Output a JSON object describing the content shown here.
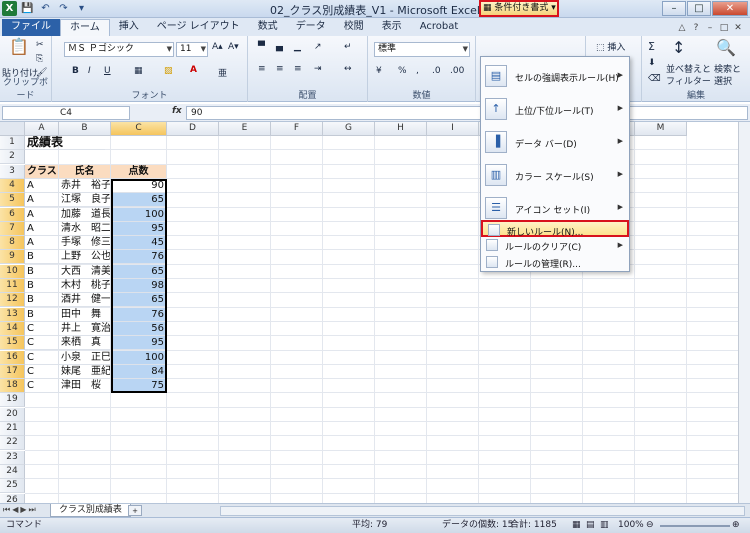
{
  "window": {
    "title": "02_クラス別成績表_V1  -  Microsoft Excel",
    "app_icon": "X"
  },
  "qat": [
    "save-icon",
    "undo-icon",
    "redo-icon",
    "customize-icon"
  ],
  "tabs": [
    "ファイル",
    "ホーム",
    "挿入",
    "ページ レイアウト",
    "数式",
    "データ",
    "校閲",
    "表示",
    "Acrobat"
  ],
  "ribbon": {
    "clipboard": {
      "label": "クリップボード",
      "paste": "貼り付け"
    },
    "font": {
      "label": "フォント",
      "name": "ＭＳ Ｐゴシック",
      "size": "11",
      "bold": "B",
      "italic": "I",
      "underline": "U"
    },
    "alignment": {
      "label": "配置"
    },
    "number": {
      "label": "数値",
      "format": "標準",
      "percent": "%"
    },
    "styles": {
      "cond_format": "条件付き書式"
    },
    "cells": {
      "insert": "挿入"
    },
    "editing": {
      "label": "編集",
      "sum": "Σ",
      "sort": "並べ替えと",
      "filter": "フィルター",
      "find": "検索と",
      "select": "選択"
    }
  },
  "formula_bar": {
    "name_box": "C4",
    "fx": "fx",
    "value": "90"
  },
  "columns": [
    "A",
    "B",
    "C",
    "D",
    "E",
    "F",
    "G",
    "H",
    "I",
    "J",
    "K",
    "L",
    "M"
  ],
  "rows": [
    "1",
    "2",
    "3",
    "4",
    "5",
    "6",
    "7",
    "8",
    "9",
    "10",
    "11",
    "12",
    "13",
    "14",
    "15",
    "16",
    "17",
    "18",
    "19",
    "20",
    "21",
    "22",
    "23",
    "24",
    "25",
    "26"
  ],
  "sheet": {
    "title": "成績表",
    "headers": [
      "クラス",
      "氏名",
      "点数"
    ],
    "data": [
      [
        "A",
        "赤井　裕子",
        "90"
      ],
      [
        "A",
        "江塚　良子",
        "65"
      ],
      [
        "A",
        "加藤　道長",
        "100"
      ],
      [
        "A",
        "清水　昭二",
        "95"
      ],
      [
        "A",
        "手塚　修三",
        "45"
      ],
      [
        "B",
        "上野　公也",
        "76"
      ],
      [
        "B",
        "大西　清美",
        "65"
      ],
      [
        "B",
        "木村　桃子",
        "98"
      ],
      [
        "B",
        "酒井　健一",
        "65"
      ],
      [
        "B",
        "田中　舞",
        "76"
      ],
      [
        "C",
        "井上　寛治",
        "56"
      ],
      [
        "C",
        "来栖　真",
        "95"
      ],
      [
        "C",
        "小泉　正巳",
        "100"
      ],
      [
        "C",
        "妹尾　亜紀",
        "84"
      ],
      [
        "C",
        "津田　桜",
        "75"
      ]
    ]
  },
  "dropdown": {
    "items": [
      {
        "label": "セルの強調表示ルール(H)",
        "icon": "highlight-rules-icon",
        "submenu": true
      },
      {
        "label": "上位/下位ルール(T)",
        "icon": "top-bottom-icon",
        "submenu": true
      },
      {
        "label": "データ バー(D)",
        "icon": "data-bar-icon",
        "submenu": true
      },
      {
        "label": "カラー スケール(S)",
        "icon": "color-scale-icon",
        "submenu": true
      },
      {
        "label": "アイコン セット(I)",
        "icon": "icon-set-icon",
        "submenu": true
      }
    ],
    "small_items": [
      {
        "label": "新しいルール(N)...",
        "highlighted": true
      },
      {
        "label": "ルールのクリア(C)",
        "submenu": true
      },
      {
        "label": "ルールの管理(R)..."
      }
    ]
  },
  "sheet_tabs": {
    "active": "クラス別成績表"
  },
  "status": {
    "mode": "コマンド",
    "average": "平均: 79",
    "count": "データの個数: 15",
    "sum": "合計: 1185",
    "zoom": "100%"
  }
}
